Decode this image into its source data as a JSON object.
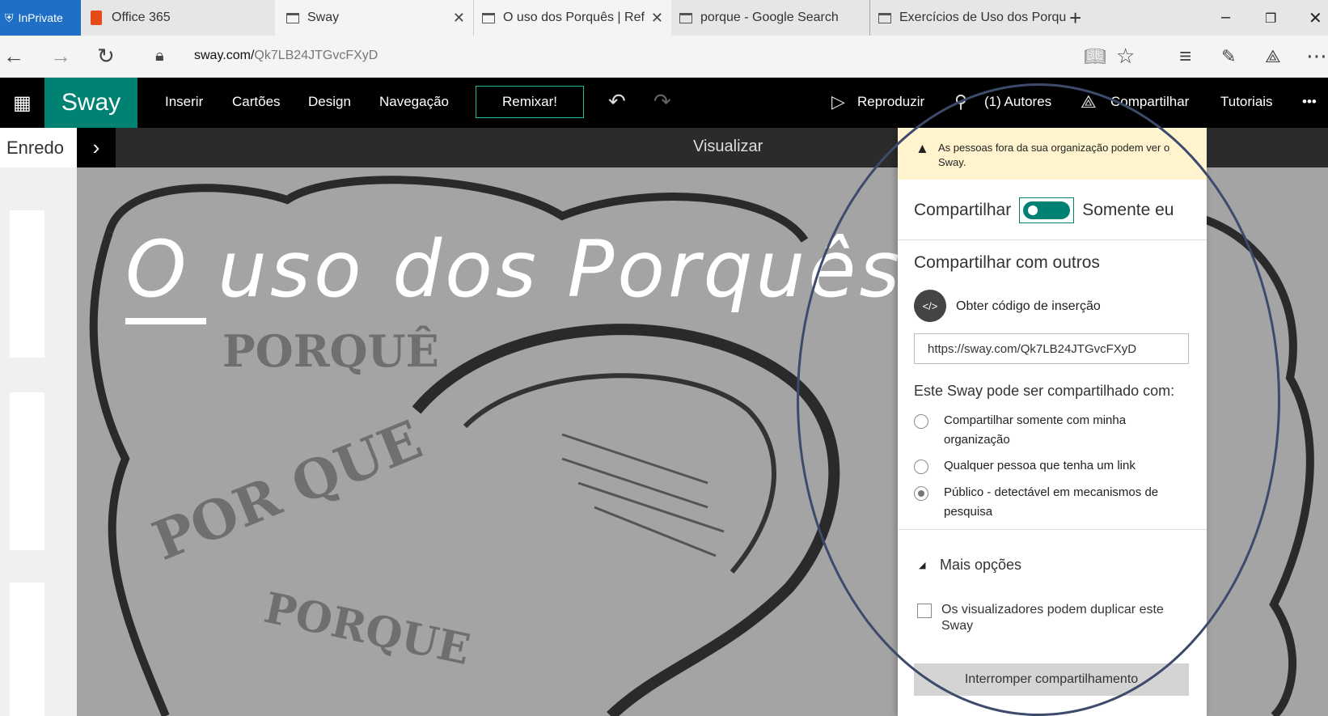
{
  "browser": {
    "tabs": [
      {
        "label": "InPrivate"
      },
      {
        "label": "Office 365"
      },
      {
        "label": "Sway"
      },
      {
        "label": "O uso dos Porquês | Ref"
      },
      {
        "label": "porque - Google Search"
      },
      {
        "label": "Exercícios de Uso dos Porqu"
      }
    ],
    "new_tab": "+",
    "url_domain": "sway.com/",
    "url_path": "Qk7LB24JTGvcFXyD"
  },
  "appbar": {
    "brand": "Sway",
    "menu": [
      "Inserir",
      "Cartões",
      "Design",
      "Navegação"
    ],
    "remix": "Remixar!",
    "play": "Reproduzir",
    "authors": "(1) Autores",
    "share": "Compartilhar",
    "tutorials": "Tutoriais",
    "more": "•••"
  },
  "subbar": {
    "storyline": "Enredo",
    "preview": "Visualizar"
  },
  "canvas": {
    "title": "O uso dos Porquês",
    "words": [
      "PORQUÊ",
      "POR QUE",
      "PORQUE"
    ]
  },
  "share_panel": {
    "warning": "As pessoas fora da sua organização podem ver o Sway.",
    "share_label": "Compartilhar",
    "share_state": "Somente eu",
    "others_title": "Compartilhar com outros",
    "embed_icon_text": "</>",
    "embed_label": "Obter código de inserção",
    "link": "https://sway.com/Qk7LB24JTGvcFXyD",
    "perm_title": "Este Sway pode ser compartilhado com:",
    "options": [
      {
        "label": "Compartilhar somente com minha organização",
        "selected": false
      },
      {
        "label": "Qualquer pessoa que tenha um link",
        "selected": false
      },
      {
        "label": "Público - detectável em mecanismos de pesquisa",
        "selected": true
      }
    ],
    "more_options": "Mais opções",
    "duplicate_label": "Os visualizadores podem duplicar este Sway",
    "duplicate_checked": false,
    "stop_button": "Interromper compartilhamento"
  },
  "colors": {
    "sway_green": "#008272",
    "inprivate_blue": "#1f6fc6",
    "warning_bg": "#fff4ce",
    "annotation": "#3d4a6b"
  }
}
